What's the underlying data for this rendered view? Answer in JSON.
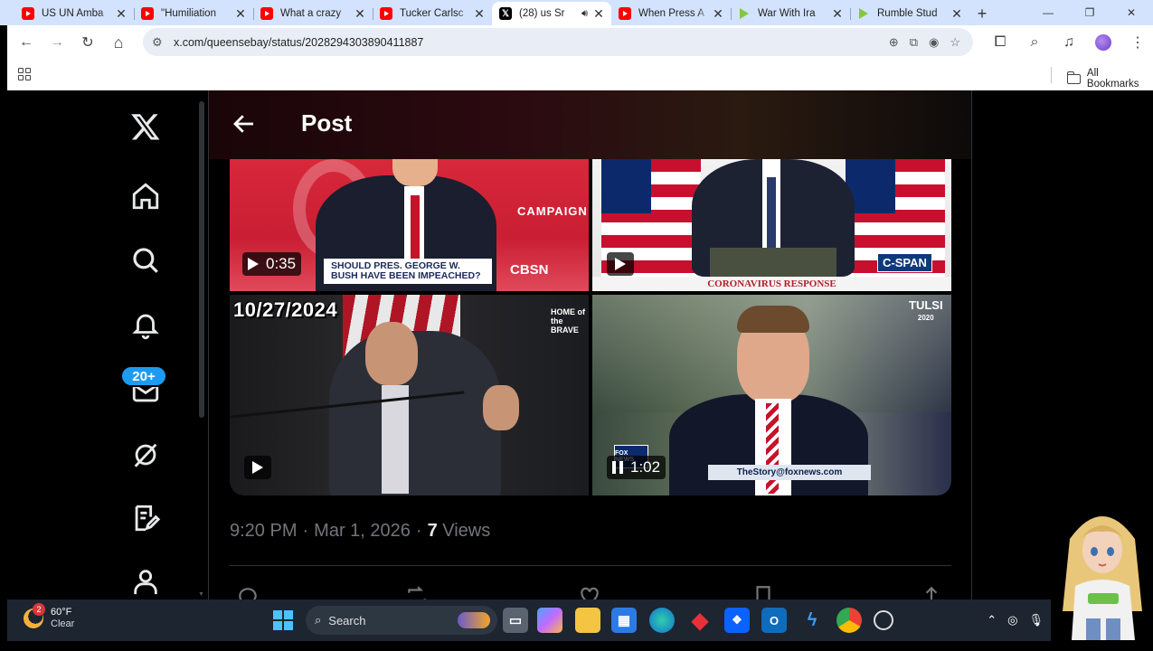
{
  "browser": {
    "tabs": [
      {
        "title": "US UN Amba",
        "favicon": "youtube-icon",
        "active": false
      },
      {
        "title": "\"Humiliation",
        "favicon": "youtube-icon",
        "active": false
      },
      {
        "title": "What a crazy",
        "favicon": "youtube-icon",
        "active": false
      },
      {
        "title": "Tucker Carlsc",
        "favicon": "youtube-icon",
        "active": false
      },
      {
        "title": "(28) us Sr",
        "favicon": "x-icon",
        "active": true,
        "audio": true
      },
      {
        "title": "When Press A",
        "favicon": "youtube-icon",
        "active": false
      },
      {
        "title": "War With Ira",
        "favicon": "rumble-icon",
        "active": false
      },
      {
        "title": "Rumble Stud",
        "favicon": "rumble-icon",
        "active": false
      }
    ],
    "new_tab_symbol": "+",
    "window_controls": {
      "minimize": "—",
      "restore": "❐",
      "close": "✕"
    },
    "nav": {
      "back": "←",
      "forward": "→",
      "reload": "↻",
      "home": "⌂"
    },
    "url": "x.com/queensebay/status/2028294303890411887",
    "bookmarks": {
      "all_label": "All Bookmarks"
    }
  },
  "x": {
    "header": {
      "title": "Post"
    },
    "badge_count": "20+",
    "media": [
      {
        "duration": "0:35",
        "chyron": "SHOULD PRES. GEORGE W. BUSH HAVE BEEN IMPEACHED?",
        "network": "CBSN",
        "banner": "CAMPAIGN"
      },
      {
        "chyron": "CORONAVIRUS RESPONSE",
        "network": "C-SPAN"
      },
      {
        "date_overlay": "10/27/2024",
        "network": "HOME of the BRAVE"
      },
      {
        "duration": "1:02",
        "chyron": "TheStory@foxnews.com",
        "network": "TULSI",
        "network_year": "2020",
        "fox_label": "FOX NEWS"
      }
    ],
    "meta": {
      "time": "9:20 PM",
      "sep1": "·",
      "date": "Mar 1, 2026",
      "sep2": "·",
      "views_count": "7",
      "views_label": "Views"
    }
  },
  "taskbar": {
    "weather": {
      "temp": "60°F",
      "condition": "Clear",
      "alert_count": "2"
    },
    "search_label": "Search"
  },
  "colors": {
    "tab_strip": "#d3e3fd",
    "x_blue": "#1d9bf0",
    "x_text": "#e7e9ea",
    "x_muted": "#71767b",
    "taskbar": "#1c2530"
  }
}
